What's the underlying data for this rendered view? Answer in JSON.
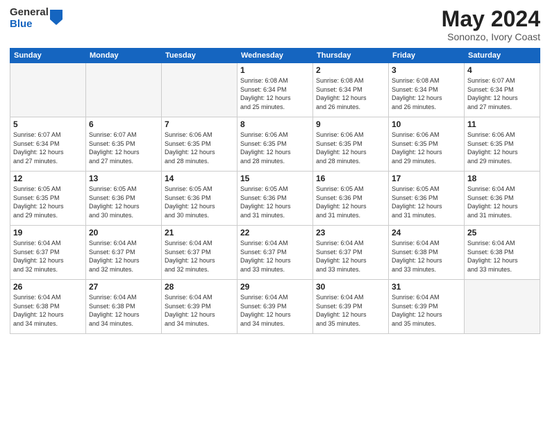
{
  "logo": {
    "general": "General",
    "blue": "Blue"
  },
  "title": {
    "month": "May 2024",
    "location": "Sononzo, Ivory Coast"
  },
  "days_of_week": [
    "Sunday",
    "Monday",
    "Tuesday",
    "Wednesday",
    "Thursday",
    "Friday",
    "Saturday"
  ],
  "weeks": [
    [
      {
        "day": "",
        "info": ""
      },
      {
        "day": "",
        "info": ""
      },
      {
        "day": "",
        "info": ""
      },
      {
        "day": "1",
        "info": "Sunrise: 6:08 AM\nSunset: 6:34 PM\nDaylight: 12 hours\nand 25 minutes."
      },
      {
        "day": "2",
        "info": "Sunrise: 6:08 AM\nSunset: 6:34 PM\nDaylight: 12 hours\nand 26 minutes."
      },
      {
        "day": "3",
        "info": "Sunrise: 6:08 AM\nSunset: 6:34 PM\nDaylight: 12 hours\nand 26 minutes."
      },
      {
        "day": "4",
        "info": "Sunrise: 6:07 AM\nSunset: 6:34 PM\nDaylight: 12 hours\nand 27 minutes."
      }
    ],
    [
      {
        "day": "5",
        "info": "Sunrise: 6:07 AM\nSunset: 6:34 PM\nDaylight: 12 hours\nand 27 minutes."
      },
      {
        "day": "6",
        "info": "Sunrise: 6:07 AM\nSunset: 6:35 PM\nDaylight: 12 hours\nand 27 minutes."
      },
      {
        "day": "7",
        "info": "Sunrise: 6:06 AM\nSunset: 6:35 PM\nDaylight: 12 hours\nand 28 minutes."
      },
      {
        "day": "8",
        "info": "Sunrise: 6:06 AM\nSunset: 6:35 PM\nDaylight: 12 hours\nand 28 minutes."
      },
      {
        "day": "9",
        "info": "Sunrise: 6:06 AM\nSunset: 6:35 PM\nDaylight: 12 hours\nand 28 minutes."
      },
      {
        "day": "10",
        "info": "Sunrise: 6:06 AM\nSunset: 6:35 PM\nDaylight: 12 hours\nand 29 minutes."
      },
      {
        "day": "11",
        "info": "Sunrise: 6:06 AM\nSunset: 6:35 PM\nDaylight: 12 hours\nand 29 minutes."
      }
    ],
    [
      {
        "day": "12",
        "info": "Sunrise: 6:05 AM\nSunset: 6:35 PM\nDaylight: 12 hours\nand 29 minutes."
      },
      {
        "day": "13",
        "info": "Sunrise: 6:05 AM\nSunset: 6:36 PM\nDaylight: 12 hours\nand 30 minutes."
      },
      {
        "day": "14",
        "info": "Sunrise: 6:05 AM\nSunset: 6:36 PM\nDaylight: 12 hours\nand 30 minutes."
      },
      {
        "day": "15",
        "info": "Sunrise: 6:05 AM\nSunset: 6:36 PM\nDaylight: 12 hours\nand 31 minutes."
      },
      {
        "day": "16",
        "info": "Sunrise: 6:05 AM\nSunset: 6:36 PM\nDaylight: 12 hours\nand 31 minutes."
      },
      {
        "day": "17",
        "info": "Sunrise: 6:05 AM\nSunset: 6:36 PM\nDaylight: 12 hours\nand 31 minutes."
      },
      {
        "day": "18",
        "info": "Sunrise: 6:04 AM\nSunset: 6:36 PM\nDaylight: 12 hours\nand 31 minutes."
      }
    ],
    [
      {
        "day": "19",
        "info": "Sunrise: 6:04 AM\nSunset: 6:37 PM\nDaylight: 12 hours\nand 32 minutes."
      },
      {
        "day": "20",
        "info": "Sunrise: 6:04 AM\nSunset: 6:37 PM\nDaylight: 12 hours\nand 32 minutes."
      },
      {
        "day": "21",
        "info": "Sunrise: 6:04 AM\nSunset: 6:37 PM\nDaylight: 12 hours\nand 32 minutes."
      },
      {
        "day": "22",
        "info": "Sunrise: 6:04 AM\nSunset: 6:37 PM\nDaylight: 12 hours\nand 33 minutes."
      },
      {
        "day": "23",
        "info": "Sunrise: 6:04 AM\nSunset: 6:37 PM\nDaylight: 12 hours\nand 33 minutes."
      },
      {
        "day": "24",
        "info": "Sunrise: 6:04 AM\nSunset: 6:38 PM\nDaylight: 12 hours\nand 33 minutes."
      },
      {
        "day": "25",
        "info": "Sunrise: 6:04 AM\nSunset: 6:38 PM\nDaylight: 12 hours\nand 33 minutes."
      }
    ],
    [
      {
        "day": "26",
        "info": "Sunrise: 6:04 AM\nSunset: 6:38 PM\nDaylight: 12 hours\nand 34 minutes."
      },
      {
        "day": "27",
        "info": "Sunrise: 6:04 AM\nSunset: 6:38 PM\nDaylight: 12 hours\nand 34 minutes."
      },
      {
        "day": "28",
        "info": "Sunrise: 6:04 AM\nSunset: 6:39 PM\nDaylight: 12 hours\nand 34 minutes."
      },
      {
        "day": "29",
        "info": "Sunrise: 6:04 AM\nSunset: 6:39 PM\nDaylight: 12 hours\nand 34 minutes."
      },
      {
        "day": "30",
        "info": "Sunrise: 6:04 AM\nSunset: 6:39 PM\nDaylight: 12 hours\nand 35 minutes."
      },
      {
        "day": "31",
        "info": "Sunrise: 6:04 AM\nSunset: 6:39 PM\nDaylight: 12 hours\nand 35 minutes."
      },
      {
        "day": "",
        "info": ""
      }
    ]
  ]
}
